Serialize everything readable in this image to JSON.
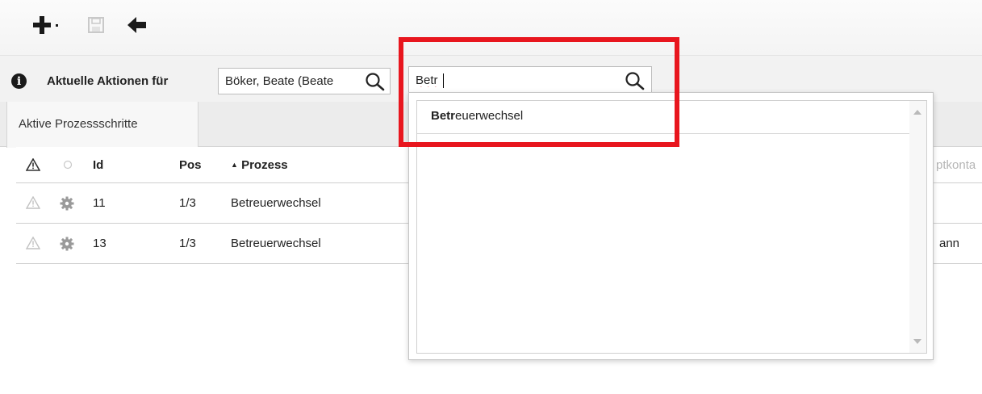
{
  "toolbar": {
    "add_icon": "plus-icon",
    "add_dropdown_icon": "chevron-down-icon",
    "save_icon": "floppy-disk-icon",
    "back_icon": "arrow-left-icon"
  },
  "filter": {
    "info_icon": "info-icon",
    "info_glyph": "i",
    "label": "Aktuelle Aktionen für",
    "person_value": "Böker, Beate (Beate",
    "process_value": "Betr"
  },
  "tabs": [
    {
      "label": "Aktive Prozessschritte",
      "active": true
    }
  ],
  "table": {
    "columns": {
      "id": "Id",
      "pos": "Pos",
      "process_sort_icon": "▲",
      "process": "Prozess",
      "clipped": "ptkonta"
    },
    "rows": [
      {
        "id": "11",
        "pos": "1/3",
        "process": "Betreuerwechsel",
        "clipped": ""
      },
      {
        "id": "13",
        "pos": "1/3",
        "process": "Betreuerwechsel",
        "clipped": "ann"
      }
    ]
  },
  "dropdown": {
    "items": [
      {
        "match": "Betr",
        "rest": "euerwechsel"
      }
    ]
  },
  "colors": {
    "highlight": "#e8161e",
    "icon_gray": "#9a9a9a"
  }
}
